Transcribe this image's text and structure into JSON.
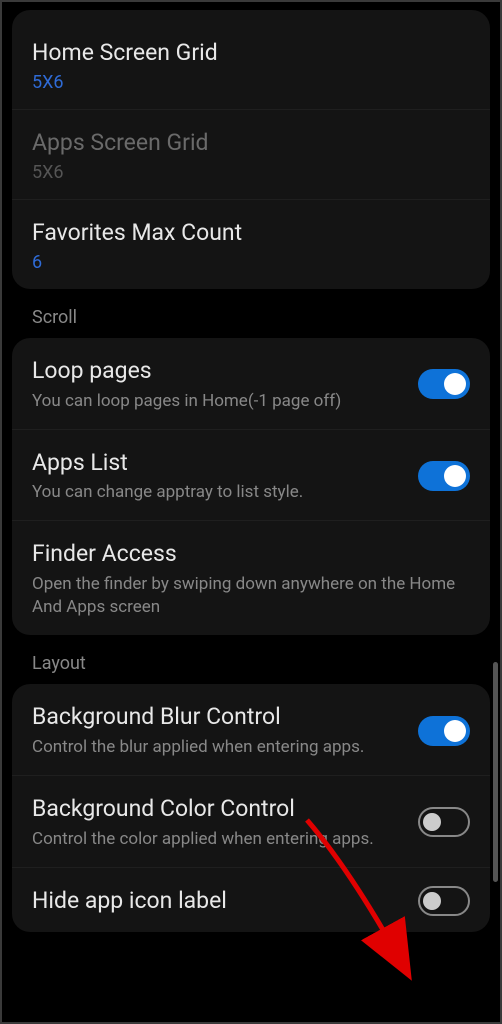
{
  "grid_section": {
    "home_grid": {
      "title": "Home Screen Grid",
      "value": "5X6"
    },
    "apps_grid": {
      "title": "Apps Screen Grid",
      "value": "5X6"
    },
    "favorites": {
      "title": "Favorites Max Count",
      "value": "6"
    }
  },
  "scroll_section": {
    "header": "Scroll",
    "loop": {
      "title": "Loop pages",
      "desc": "You can loop pages in Home(-1 page off)",
      "enabled": true
    },
    "apps_list": {
      "title": "Apps List",
      "desc": "You can change apptray to list style.",
      "enabled": true
    },
    "finder": {
      "title": "Finder Access",
      "desc": "Open the finder by swiping down anywhere on the Home And Apps screen"
    }
  },
  "layout_section": {
    "header": "Layout",
    "bg_blur": {
      "title": "Background Blur Control",
      "desc": "Control the blur applied when entering apps.",
      "enabled": true
    },
    "bg_color": {
      "title": "Background Color Control",
      "desc": "Control the color applied when entering apps.",
      "enabled": false
    },
    "hide_label": {
      "title": "Hide app icon label",
      "enabled": false
    }
  }
}
